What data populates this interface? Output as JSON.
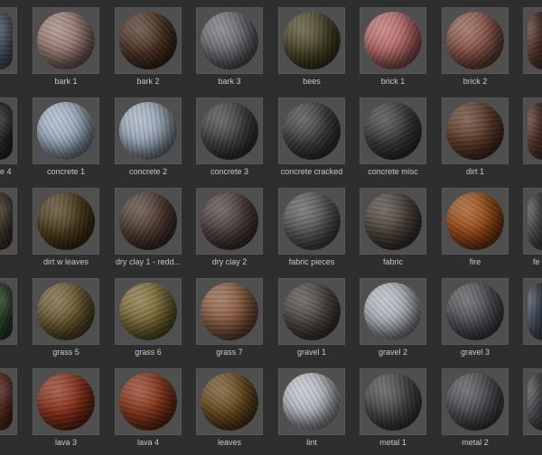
{
  "materials": [
    [
      {
        "label": "",
        "color": "#5a6a80",
        "partial": "left"
      },
      {
        "label": "bark 1",
        "color": "#9a7d74"
      },
      {
        "label": "bark 2",
        "color": "#4b3224"
      },
      {
        "label": "bark 3",
        "color": "#6c6e72"
      },
      {
        "label": "bees",
        "color": "#4a4428"
      },
      {
        "label": "brick 1",
        "color": "#b86a6a"
      },
      {
        "label": "brick 2",
        "color": "#8a5548"
      },
      {
        "label": "",
        "color": "#7a4a3a",
        "partial": "right"
      }
    ],
    [
      {
        "label": "e 4",
        "color": "#2a2a28",
        "partial": "left"
      },
      {
        "label": "concrete 1",
        "color": "#9fb0c4"
      },
      {
        "label": "concrete 2",
        "color": "#9eacbc"
      },
      {
        "label": "concrete 3",
        "color": "#3e3f42"
      },
      {
        "label": "concrete cracked",
        "color": "#3c3d3f"
      },
      {
        "label": "concrete misc",
        "color": "#38393b"
      },
      {
        "label": "dirt 1",
        "color": "#5e3a28"
      },
      {
        "label": "",
        "color": "#7a4a3a",
        "partial": "right"
      }
    ],
    [
      {
        "label": "",
        "color": "#4a3a2a",
        "partial": "left"
      },
      {
        "label": "dirt w leaves",
        "color": "#4a3a1a"
      },
      {
        "label": "dry clay 1 - redd...",
        "color": "#4e3a30"
      },
      {
        "label": "dry clay 2",
        "color": "#4c3e3a"
      },
      {
        "label": "fabric pieces",
        "color": "#55575a"
      },
      {
        "label": "fabric",
        "color": "#4a4038"
      },
      {
        "label": "fire",
        "color": "#9a4a14"
      },
      {
        "label": "fe",
        "color": "#6a6a6a",
        "partial": "right"
      }
    ],
    [
      {
        "label": "",
        "color": "#2a4a2a",
        "partial": "left"
      },
      {
        "label": "grass 5",
        "color": "#6a5a30"
      },
      {
        "label": "grass 6",
        "color": "#7a6a34"
      },
      {
        "label": "grass 7",
        "color": "#8a5a40"
      },
      {
        "label": "gravel 1",
        "color": "#4a4440"
      },
      {
        "label": "gravel 2",
        "color": "#b0b4bc"
      },
      {
        "label": "gravel 3",
        "color": "#4e5054"
      },
      {
        "label": "",
        "color": "#5a6a80",
        "partial": "right"
      }
    ],
    [
      {
        "label": "",
        "color": "#6a2a1a",
        "partial": "left"
      },
      {
        "label": "lava 3",
        "color": "#8a3018"
      },
      {
        "label": "lava 4",
        "color": "#8a3418"
      },
      {
        "label": "leaves",
        "color": "#6a4a1c"
      },
      {
        "label": "lint",
        "color": "#b8bcc4"
      },
      {
        "label": "metal 1",
        "color": "#444648"
      },
      {
        "label": "metal 2",
        "color": "#4a4c50"
      },
      {
        "label": "",
        "color": "#6a6c70",
        "partial": "right"
      }
    ]
  ]
}
